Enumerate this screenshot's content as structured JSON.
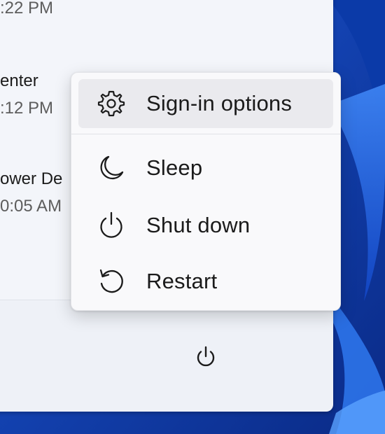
{
  "recent_items": [
    {
      "name": "",
      "time": ":22 PM"
    },
    {
      "name": "enter",
      "time": ":12 PM"
    },
    {
      "name": "ower De",
      "time": "0:05 AM"
    }
  ],
  "power_menu": {
    "items": [
      {
        "label": "Sign-in options",
        "icon": "gear-icon"
      },
      {
        "label": "Sleep",
        "icon": "moon-icon"
      },
      {
        "label": "Shut down",
        "icon": "power-icon"
      },
      {
        "label": "Restart",
        "icon": "restart-icon"
      }
    ]
  },
  "power_button": {
    "icon": "power-icon"
  },
  "colors": {
    "wallpaper": "#0d2f8f",
    "panel": "#eef1f7",
    "menu": "#f9f9fb",
    "hover": "#eaeaee",
    "text": "#1b1b1b"
  }
}
